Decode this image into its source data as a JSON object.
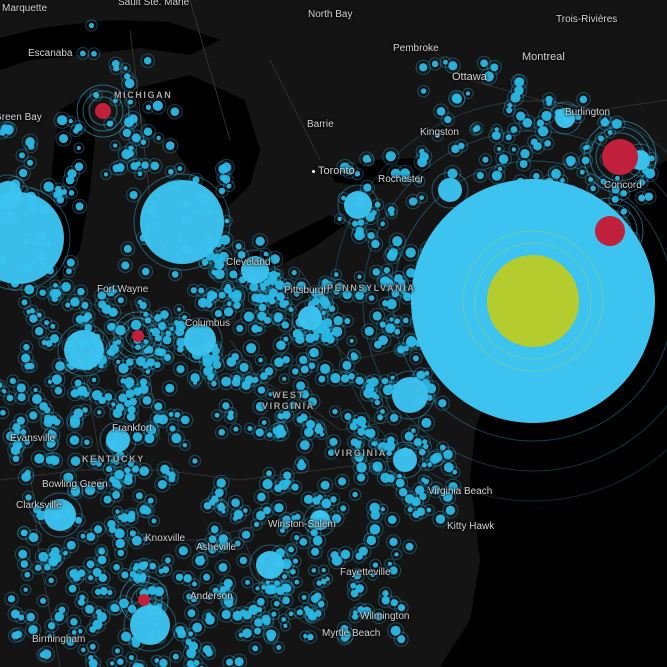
{
  "map": {
    "colors": {
      "background": "#090909",
      "land": "#141414",
      "border": "#3a3a3a",
      "small_marker": "#2ab8e6",
      "large_marker": "#3cc3ef",
      "hot_marker": "#c0203c",
      "peak_marker": "#b5cc2e"
    },
    "place_labels": [
      "Marquette",
      "Sault Ste. Marie",
      "North Bay",
      "Trois-Rivières",
      "Escanaba",
      "Pembroke",
      "Montreal",
      "Ottawa",
      "Green Bay",
      "Barrie",
      "Kingston",
      "Burlington",
      "Toronto",
      "Rochester",
      "Concord",
      "Cleveland",
      "Fort Wayne",
      "Columbus",
      "Pittsburgh",
      "Evansville",
      "Frankfort",
      "Bowling Green",
      "Clarksville",
      "Knoxville",
      "Asheville",
      "Winston-Salem",
      "Fayetteville",
      "Virginia Beach",
      "Kitty Hawk",
      "Anderson",
      "Wilmington",
      "Myrtle Beach",
      "Birmingham"
    ],
    "region_labels": [
      "MICHIGAN",
      "PENNSYLVANIA",
      "WEST\nVIRGINIA",
      "VIRGINIA",
      "KENTUCKY"
    ]
  }
}
